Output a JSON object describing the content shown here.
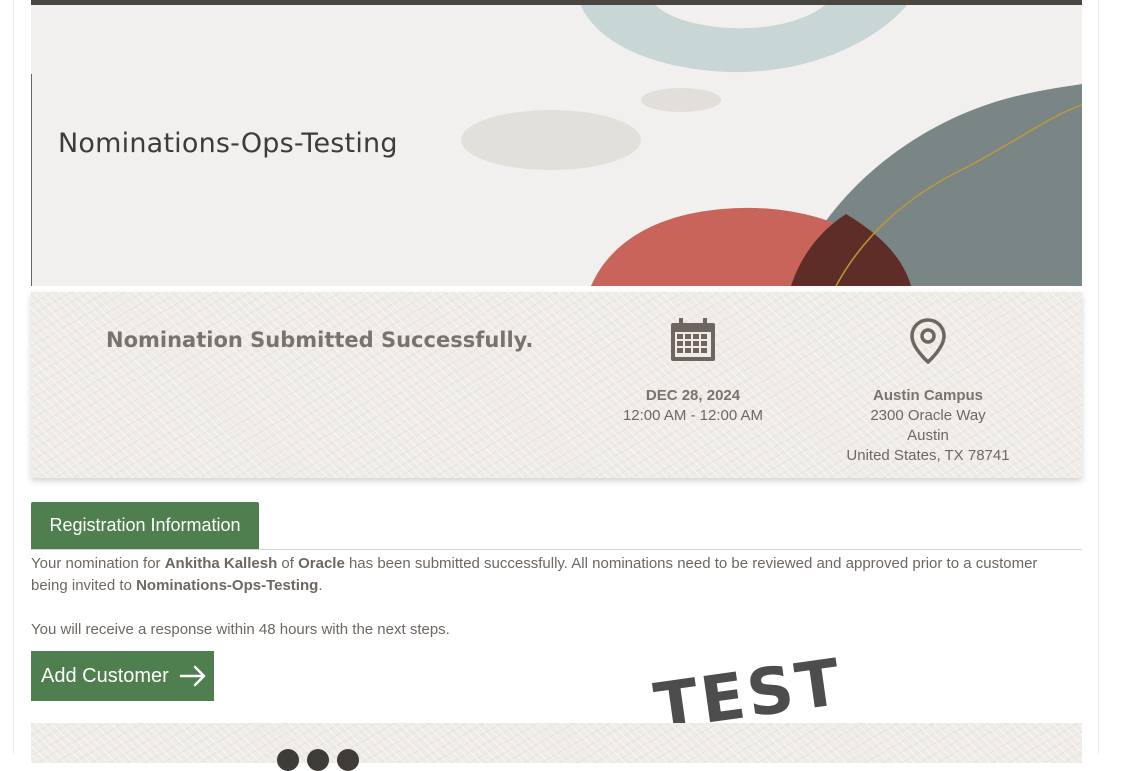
{
  "event": {
    "title": "Nominations-Ops-Testing"
  },
  "banner": {
    "status": "Nomination Submitted Successfully.",
    "date": "DEC 28, 2024",
    "time": "12:00 AM - 12:00 AM",
    "location_name": "Austin Campus",
    "address_line1": "2300 Oracle Way",
    "address_city": "Austin",
    "address_country": "United States, TX 78741"
  },
  "tabs": [
    {
      "label": "Registration Information",
      "active": true
    }
  ],
  "message": {
    "part1": "Your nomination for ",
    "nominee": "Ankitha Kallesh",
    "part2": " of ",
    "company": "Oracle",
    "part3": " has been submitted successfully. All nominations need to be reviewed and approved prior to a customer being invited to ",
    "event": "Nominations-Ops-Testing",
    "part4": ".",
    "response": "You will receive a response within 48 hours with the next steps."
  },
  "actions": {
    "add_customer": "Add Customer"
  },
  "watermark": "TEST",
  "colors": {
    "accent": "#4f7f4f",
    "text": "#6e6761",
    "hero_red": "#c9645a",
    "hero_slate": "#7a8585",
    "hero_blue": "#c8d6d6"
  },
  "icons": [
    "calendar-icon",
    "map-pin-icon",
    "arrow-right-icon"
  ]
}
